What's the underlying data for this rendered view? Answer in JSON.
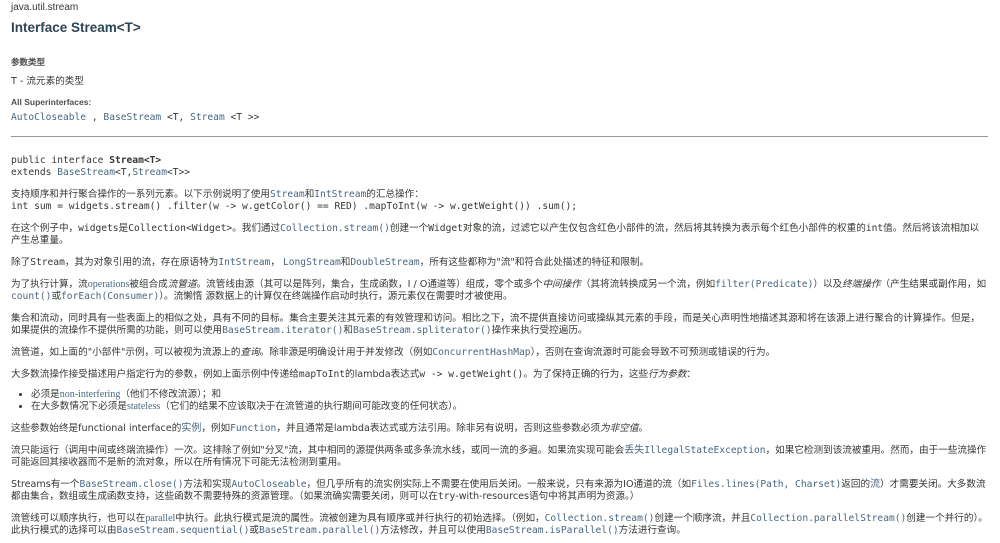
{
  "package": "java.util.stream",
  "title": "Interface Stream<T>",
  "type_params": {
    "label": "参数类型",
    "value": "T - 流元素的类型"
  },
  "superinterfaces": {
    "label": "All Superinterfaces:",
    "items": [
      "AutoCloseable",
      "BaseStream",
      "Stream"
    ],
    "sep1": " , ",
    "mid": " <T, ",
    "end": " <T >>"
  },
  "signature": {
    "line1_prefix": "public interface ",
    "line1_name": "Stream<T>",
    "line2_prefix": "extends ",
    "line2_link1": "BaseStream",
    "line2_mid": "<T,",
    "line2_link2": "Stream",
    "line2_end": "<T>>"
  },
  "colors": {
    "text": "#353833",
    "link": "#4A6782",
    "title": "#2c4557"
  },
  "blocks": [
    {
      "kind": "p",
      "segs": [
        [
          "t",
          "支持顺序和并行聚合操作的一系列元素。以下示例说明了使用"
        ],
        [
          "cl",
          "Stream"
        ],
        [
          "t",
          "和"
        ],
        [
          "cl",
          "IntStream"
        ],
        [
          "t",
          "的汇总操作："
        ]
      ]
    },
    {
      "kind": "code",
      "segs": [
        [
          "c",
          "int sum = widgets.stream() .filter(w -> w.getColor() == RED) .mapToInt(w -> w.getWeight()) .sum();"
        ]
      ]
    },
    {
      "kind": "p",
      "segs": [
        [
          "t",
          "在这个例子中，"
        ],
        [
          "c",
          "widgets"
        ],
        [
          "t",
          "是"
        ],
        [
          "c",
          "Collection<Widget>"
        ],
        [
          "t",
          "。我们通过"
        ],
        [
          "cl",
          "Collection.stream()"
        ],
        [
          "t",
          "创建一个"
        ],
        [
          "c",
          "Widget"
        ],
        [
          "t",
          "对象的流，过滤它以产生仅包含红色小部件的流，然后将其转换为表示每个红色小部件的权重的"
        ],
        [
          "c",
          "int"
        ],
        [
          "t",
          "值。然后将该流相加以产生总重量。"
        ]
      ]
    },
    {
      "kind": "p",
      "segs": [
        [
          "t",
          "除了"
        ],
        [
          "c",
          "Stream"
        ],
        [
          "t",
          "，其为对象引用的流，存在原语特为"
        ],
        [
          "cl",
          "IntStream"
        ],
        [
          "t",
          "， "
        ],
        [
          "cl",
          "LongStream"
        ],
        [
          "t",
          "和"
        ],
        [
          "cl",
          "DoubleStream"
        ],
        [
          "t",
          "，所有这些都称为\"流\"和符合此处描述的特征和限制。"
        ]
      ]
    },
    {
      "kind": "p",
      "segs": [
        [
          "t",
          "为了执行计算，流"
        ],
        [
          "l",
          "operations"
        ],
        [
          "t",
          "被组合成"
        ],
        [
          "e",
          "流管道"
        ],
        [
          "t",
          "。流管线由源（其可以是阵列，集合，生成函数，I / O通道等）组成，零个或多个"
        ],
        [
          "e",
          "中间操作"
        ],
        [
          "t",
          "（其将流转换成另一个流，例如"
        ],
        [
          "cl",
          "filter(Predicate)"
        ],
        [
          "t",
          "）以及"
        ],
        [
          "e",
          "终端操作"
        ],
        [
          "t",
          "（产生结果或副作用，如"
        ],
        [
          "cl",
          "count()"
        ],
        [
          "t",
          "或"
        ],
        [
          "cl",
          "forEach(Consumer)"
        ],
        [
          "t",
          "）。流懒惰 源数据上的计算仅在终端操作启动时执行，源元素仅在需要时才被使用。"
        ]
      ]
    },
    {
      "kind": "p",
      "segs": [
        [
          "t",
          "集合和流动，同时具有一些表面上的相似之处，具有不同的目标。集合主要关注其元素的有效管理和访问。相比之下，流不提供直接访问或操纵其元素的手段，而是关心声明性地描述其源和将在该源上进行聚合的计算操作。但是，如果提供的流操作不提供所需的功能，则可以使用"
        ],
        [
          "cl",
          "BaseStream.iterator()"
        ],
        [
          "t",
          "和"
        ],
        [
          "cl",
          "BaseStream.spliterator()"
        ],
        [
          "t",
          "操作来执行受控遍历。"
        ]
      ]
    },
    {
      "kind": "p",
      "segs": [
        [
          "t",
          "流管道，如上面的\"小部件\"示例，可以被视为流源上的"
        ],
        [
          "e",
          "查询"
        ],
        [
          "t",
          "。除非源是明确设计用于并发修改（例如"
        ],
        [
          "cl",
          "ConcurrentHashMap"
        ],
        [
          "t",
          "），否则在查询流源时可能会导致不可预测或错误的行为。"
        ]
      ]
    },
    {
      "kind": "p",
      "segs": [
        [
          "t",
          "大多数流操作接受描述用户指定行为的参数，例如上面示例中传递给"
        ],
        [
          "c",
          "mapToInt"
        ],
        [
          "t",
          "的lambda表达式"
        ],
        [
          "c",
          "w -> w.getWeight()"
        ],
        [
          "t",
          "。为了保持正确的行为，这些"
        ],
        [
          "e",
          "行为参数"
        ],
        [
          "t",
          "："
        ]
      ]
    },
    {
      "kind": "ul",
      "items": [
        [
          [
            "t",
            "必须是"
          ],
          [
            "l",
            "non-interfering"
          ],
          [
            "t",
            "（他们不修改流源）；和"
          ]
        ],
        [
          [
            "t",
            "在大多数情况下必须是"
          ],
          [
            "l",
            "stateless"
          ],
          [
            "t",
            "（它们的结果不应该取决于在流管道的执行期间可能改变的任何状态）。"
          ]
        ]
      ]
    },
    {
      "kind": "p",
      "segs": [
        [
          "t",
          "这些参数始终是functional interface的"
        ],
        [
          "l",
          "实例"
        ],
        [
          "t",
          "，例如"
        ],
        [
          "cl",
          "Function"
        ],
        [
          "t",
          "，并且通常是lambda表达式或方法引用。除非另有说明，否则这些参数必须"
        ],
        [
          "e",
          "为非空值"
        ],
        [
          "t",
          "。"
        ]
      ]
    },
    {
      "kind": "p",
      "segs": [
        [
          "t",
          "流只能运行（调用中间或终端流操作）一次。这排除了例如\"分叉\"流，其中相同的源提供两条或多条流水线，或同一流的多遍。如果流实现可能会"
        ],
        [
          "l",
          "丢失"
        ],
        [
          "cl",
          "IllegalStateException"
        ],
        [
          "t",
          "，如果它检测到该流被重用。然而，由于一些流操作可能返回其接收器而不是新的流对象，所以在所有情况下可能无法检测到重用。"
        ]
      ]
    },
    {
      "kind": "p",
      "segs": [
        [
          "t",
          "Streams有一个"
        ],
        [
          "cl",
          "BaseStream.close()"
        ],
        [
          "t",
          "方法和实现"
        ],
        [
          "cl",
          "AutoCloseable"
        ],
        [
          "t",
          "，但几乎所有的流实例实际上不需要在使用后关闭。一般来说，只有来源为IO通道的流（如"
        ],
        [
          "cl",
          "Files.lines(Path, Charset)"
        ],
        [
          "t",
          "返回的"
        ],
        [
          "l",
          "流"
        ],
        [
          "t",
          "）才需要关闭。大多数流都由集合，数组或生成函数支持，这些函数不需要特殊的资源管理。（如果流确实需要关闭，则可以在"
        ],
        [
          "c",
          "try"
        ],
        [
          "t",
          "-with-resources语句中将其声明为资源。）"
        ]
      ]
    },
    {
      "kind": "p",
      "segs": [
        [
          "t",
          "流管线可以顺序执行，也可以在"
        ],
        [
          "l",
          "parallel"
        ],
        [
          "t",
          "中执行。此执行模式是流的属性。流被创建为具有顺序或并行执行的初始选择。（例如，"
        ],
        [
          "cl",
          "Collection.stream()"
        ],
        [
          "t",
          "创建一个顺序流，并且"
        ],
        [
          "cl",
          "Collection.parallelStream()"
        ],
        [
          "t",
          "创建一个并行的）。此执行模式的选择可以由"
        ],
        [
          "cl",
          "BaseStream.sequential()"
        ],
        [
          "t",
          "或"
        ],
        [
          "cl",
          "BaseStream.parallel()"
        ],
        [
          "t",
          "方法修改，并且可以使用"
        ],
        [
          "cl",
          "BaseStream.isParallel()"
        ],
        [
          "t",
          "方法进行查询。"
        ]
      ]
    }
  ]
}
